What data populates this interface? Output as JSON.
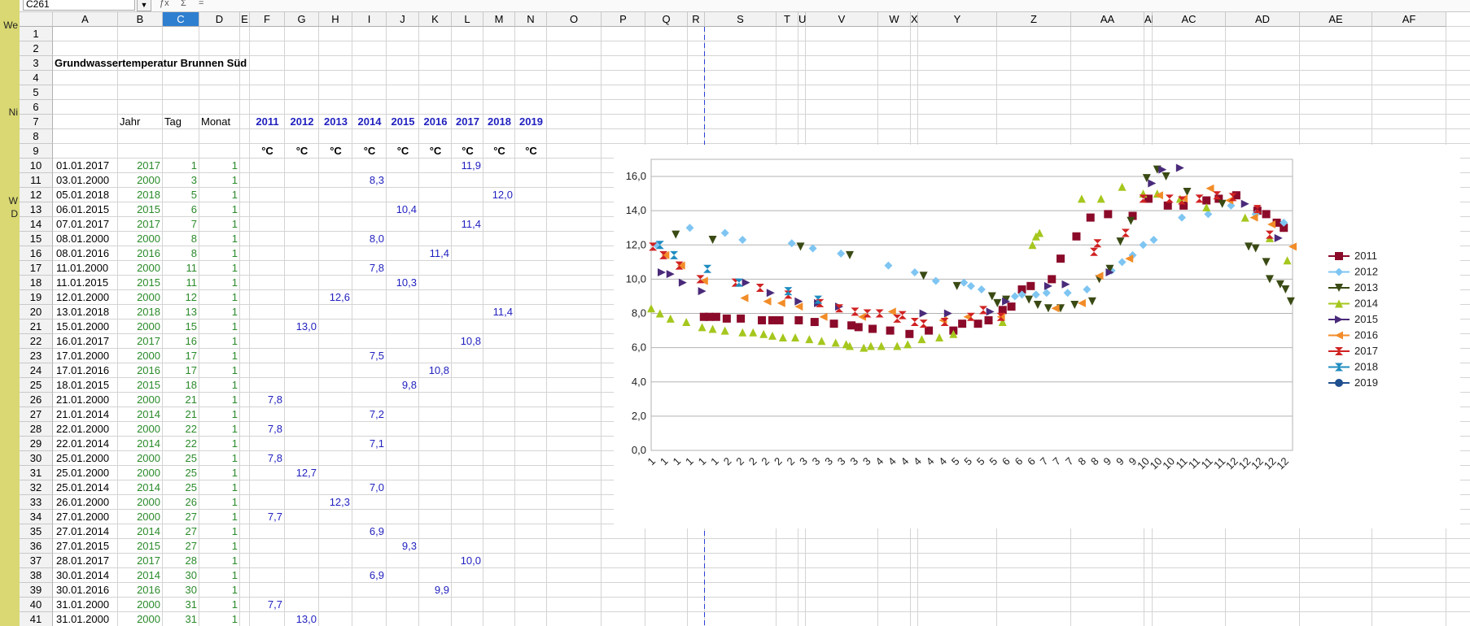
{
  "name_box": "C261",
  "left_strip": [
    "We",
    "Ni",
    "W",
    "D"
  ],
  "toolbar_icons": [
    "function-wizard-icon",
    "sum-icon",
    "formula-icon"
  ],
  "columns": [
    "A",
    "B",
    "C",
    "D",
    "E",
    "F",
    "G",
    "H",
    "I",
    "J",
    "K",
    "L",
    "M",
    "N",
    "O",
    "P",
    "Q",
    "R",
    "S",
    "T",
    "U",
    "V",
    "W",
    "X",
    "Y",
    "Z",
    "AA",
    "AB",
    "AC",
    "AD",
    "AE",
    "AF"
  ],
  "selected_column": "C",
  "title_cell": "Grundwassertemperatur Brunnen Süd",
  "header_labels": {
    "jahr": "Jahr",
    "tag": "Tag",
    "monat": "Monat"
  },
  "year_headers": [
    "2011",
    "2012",
    "2013",
    "2014",
    "2015",
    "2016",
    "2017",
    "2018",
    "2019"
  ],
  "unit": "°C",
  "row_numbers": [
    1,
    2,
    3,
    4,
    5,
    6,
    7,
    8,
    9,
    10,
    11,
    12,
    13,
    14,
    15,
    16,
    17,
    18,
    19,
    20,
    21,
    22,
    23,
    24,
    25,
    26,
    27,
    28,
    29,
    30,
    31,
    32,
    33,
    34,
    35,
    36,
    37,
    38,
    39,
    40,
    41
  ],
  "rows": [
    {
      "date": "01.01.2017",
      "jahr": "2017",
      "tag": "1",
      "monat": "1",
      "col": "L",
      "val": "11,9"
    },
    {
      "date": "03.01.2000",
      "jahr": "2000",
      "tag": "3",
      "monat": "1",
      "col": "I",
      "val": "8,3"
    },
    {
      "date": "05.01.2018",
      "jahr": "2018",
      "tag": "5",
      "monat": "1",
      "col": "M",
      "val": "12,0"
    },
    {
      "date": "06.01.2015",
      "jahr": "2015",
      "tag": "6",
      "monat": "1",
      "col": "J",
      "val": "10,4"
    },
    {
      "date": "07.01.2017",
      "jahr": "2017",
      "tag": "7",
      "monat": "1",
      "col": "L",
      "val": "11,4"
    },
    {
      "date": "08.01.2000",
      "jahr": "2000",
      "tag": "8",
      "monat": "1",
      "col": "I",
      "val": "8,0"
    },
    {
      "date": "08.01.2016",
      "jahr": "2016",
      "tag": "8",
      "monat": "1",
      "col": "K",
      "val": "11,4"
    },
    {
      "date": "11.01.2000",
      "jahr": "2000",
      "tag": "11",
      "monat": "1",
      "col": "I",
      "val": "7,8"
    },
    {
      "date": "11.01.2015",
      "jahr": "2015",
      "tag": "11",
      "monat": "1",
      "col": "J",
      "val": "10,3"
    },
    {
      "date": "12.01.2000",
      "jahr": "2000",
      "tag": "12",
      "monat": "1",
      "col": "H",
      "val": "12,6"
    },
    {
      "date": "13.01.2018",
      "jahr": "2018",
      "tag": "13",
      "monat": "1",
      "col": "M",
      "val": "11,4"
    },
    {
      "date": "15.01.2000",
      "jahr": "2000",
      "tag": "15",
      "monat": "1",
      "col": "G",
      "val": "13,0"
    },
    {
      "date": "16.01.2017",
      "jahr": "2017",
      "tag": "16",
      "monat": "1",
      "col": "L",
      "val": "10,8"
    },
    {
      "date": "17.01.2000",
      "jahr": "2000",
      "tag": "17",
      "monat": "1",
      "col": "I",
      "val": "7,5"
    },
    {
      "date": "17.01.2016",
      "jahr": "2016",
      "tag": "17",
      "monat": "1",
      "col": "K",
      "val": "10,8"
    },
    {
      "date": "18.01.2015",
      "jahr": "2015",
      "tag": "18",
      "monat": "1",
      "col": "J",
      "val": "9,8"
    },
    {
      "date": "21.01.2000",
      "jahr": "2000",
      "tag": "21",
      "monat": "1",
      "col": "F",
      "val": "7,8"
    },
    {
      "date": "21.01.2014",
      "jahr": "2014",
      "tag": "21",
      "monat": "1",
      "col": "I",
      "val": "7,2"
    },
    {
      "date": "22.01.2000",
      "jahr": "2000",
      "tag": "22",
      "monat": "1",
      "col": "F",
      "val": "7,8"
    },
    {
      "date": "22.01.2014",
      "jahr": "2014",
      "tag": "22",
      "monat": "1",
      "col": "I",
      "val": "7,1"
    },
    {
      "date": "25.01.2000",
      "jahr": "2000",
      "tag": "25",
      "monat": "1",
      "col": "F",
      "val": "7,8"
    },
    {
      "date": "25.01.2000",
      "jahr": "2000",
      "tag": "25",
      "monat": "1",
      "col": "G",
      "val": "12,7"
    },
    {
      "date": "25.01.2014",
      "jahr": "2014",
      "tag": "25",
      "monat": "1",
      "col": "I",
      "val": "7,0"
    },
    {
      "date": "26.01.2000",
      "jahr": "2000",
      "tag": "26",
      "monat": "1",
      "col": "H",
      "val": "12,3"
    },
    {
      "date": "27.01.2000",
      "jahr": "2000",
      "tag": "27",
      "monat": "1",
      "col": "F",
      "val": "7,7"
    },
    {
      "date": "27.01.2014",
      "jahr": "2014",
      "tag": "27",
      "monat": "1",
      "col": "I",
      "val": "6,9"
    },
    {
      "date": "27.01.2015",
      "jahr": "2015",
      "tag": "27",
      "monat": "1",
      "col": "J",
      "val": "9,3"
    },
    {
      "date": "28.01.2017",
      "jahr": "2017",
      "tag": "28",
      "monat": "1",
      "col": "L",
      "val": "10,0"
    },
    {
      "date": "30.01.2014",
      "jahr": "2014",
      "tag": "30",
      "monat": "1",
      "col": "I",
      "val": "6,9"
    },
    {
      "date": "30.01.2016",
      "jahr": "2016",
      "tag": "30",
      "monat": "1",
      "col": "K",
      "val": "9,9"
    },
    {
      "date": "31.01.2000",
      "jahr": "2000",
      "tag": "31",
      "monat": "1",
      "col": "F",
      "val": "7,7"
    },
    {
      "date": "31.01.2000",
      "jahr": "2000",
      "tag": "31",
      "monat": "1",
      "col": "G",
      "val": "13,0"
    }
  ],
  "chart_data": {
    "type": "scatter",
    "y_tick_labels": [
      "0,0",
      "2,0",
      "4,0",
      "6,0",
      "8,0",
      "10,0",
      "12,0",
      "14,0",
      "16,0"
    ],
    "x_tick_labels": [
      "1",
      "1",
      "1",
      "1",
      "1",
      "1",
      "2",
      "2",
      "2",
      "2",
      "2",
      "2",
      "3",
      "3",
      "3",
      "3",
      "3",
      "3",
      "4",
      "4",
      "4",
      "4",
      "4",
      "4",
      "5",
      "5",
      "5",
      "5",
      "6",
      "6",
      "6",
      "7",
      "7",
      "7",
      "8",
      "8",
      "9",
      "9",
      "9",
      "10",
      "10",
      "10",
      "11",
      "11",
      "11",
      "11",
      "12",
      "12",
      "12",
      "12",
      "12"
    ],
    "ylim": [
      0,
      17
    ],
    "x_range": [
      0,
      365
    ],
    "grid": "horizontal",
    "legend": "right",
    "series": [
      {
        "name": "2011",
        "color": "#8b0a2a",
        "marker": "square",
        "x": [
          30,
          33,
          37,
          43,
          51,
          63,
          69,
          73,
          84,
          93,
          104,
          114,
          118,
          126,
          136,
          147,
          158,
          172,
          177,
          186,
          192,
          200,
          205,
          211,
          216,
          228,
          233,
          242,
          250,
          260,
          274,
          283,
          294,
          303,
          316,
          323,
          333,
          345,
          350,
          356,
          360
        ],
        "y": [
          7.8,
          7.8,
          7.8,
          7.7,
          7.7,
          7.6,
          7.6,
          7.6,
          7.6,
          7.5,
          7.4,
          7.3,
          7.2,
          7.1,
          7.0,
          6.8,
          7.0,
          7.0,
          7.4,
          7.4,
          7.6,
          8.2,
          8.4,
          9.4,
          9.6,
          10.0,
          11.2,
          12.5,
          13.6,
          13.8,
          13.7,
          14.7,
          14.3,
          14.3,
          14.6,
          14.7,
          14.9,
          14.0,
          13.8,
          13.3,
          13.0
        ]
      },
      {
        "name": "2012",
        "color": "#7ec5f2",
        "marker": "diamond",
        "x": [
          3,
          22,
          42,
          52,
          80,
          92,
          108,
          135,
          150,
          162,
          178,
          182,
          188,
          207,
          211,
          219,
          225,
          237,
          248,
          262,
          268,
          274,
          280,
          286,
          302,
          317,
          330,
          344,
          360
        ],
        "y": [
          12.0,
          13.0,
          12.7,
          12.3,
          12.1,
          11.8,
          11.5,
          10.8,
          10.4,
          9.9,
          9.8,
          9.6,
          9.4,
          9.0,
          9.1,
          9.1,
          9.2,
          9.2,
          9.4,
          10.5,
          11.0,
          11.4,
          12.0,
          12.3,
          13.6,
          13.8,
          14.3,
          13.8,
          13.3
        ]
      },
      {
        "name": "2013",
        "color": "#3a4a14",
        "marker": "triangle-down",
        "x": [
          14,
          35,
          85,
          113,
          155,
          174,
          194,
          197,
          202,
          215,
          220,
          226,
          233,
          241,
          251,
          255,
          261,
          267,
          273,
          282,
          288,
          293,
          305,
          325,
          340,
          344,
          350,
          352,
          358,
          361,
          364
        ],
        "y": [
          12.6,
          12.3,
          11.9,
          11.4,
          10.2,
          9.6,
          9.0,
          8.6,
          8.8,
          8.8,
          8.5,
          8.3,
          8.3,
          8.5,
          8.7,
          10.0,
          10.6,
          12.2,
          13.4,
          15.9,
          16.4,
          16.0,
          15.1,
          14.4,
          11.9,
          11.8,
          11.0,
          10.0,
          9.7,
          9.4,
          8.7
        ]
      },
      {
        "name": "2014",
        "color": "#a5c71e",
        "marker": "triangle-up",
        "x": [
          0,
          5,
          11,
          20,
          29,
          35,
          42,
          52,
          58,
          64,
          69,
          75,
          82,
          90,
          97,
          105,
          111,
          113,
          121,
          125,
          131,
          140,
          146,
          154,
          164,
          172,
          200,
          217,
          219,
          221,
          245,
          256,
          268,
          280,
          288,
          301,
          316,
          338,
          352,
          362
        ],
        "y": [
          8.3,
          8.0,
          7.7,
          7.5,
          7.2,
          7.1,
          7.0,
          6.9,
          6.9,
          6.8,
          6.7,
          6.6,
          6.6,
          6.5,
          6.4,
          6.3,
          6.2,
          6.1,
          6.0,
          6.1,
          6.1,
          6.1,
          6.2,
          6.5,
          6.6,
          6.8,
          7.5,
          12.0,
          12.5,
          12.7,
          14.7,
          14.7,
          15.4,
          15.0,
          15.0,
          14.7,
          14.2,
          13.6,
          12.4,
          11.1
        ]
      },
      {
        "name": "2015",
        "color": "#4a2a7a",
        "marker": "triangle-right",
        "x": [
          6,
          11,
          18,
          29,
          54,
          68,
          84,
          95,
          107,
          155,
          169,
          193,
          202,
          226,
          236,
          261,
          285,
          291,
          301,
          338,
          357
        ],
        "y": [
          10.4,
          10.3,
          9.8,
          9.3,
          9.8,
          9.2,
          8.7,
          8.6,
          8.4,
          8.0,
          8.0,
          8.1,
          8.7,
          9.6,
          9.7,
          10.4,
          15.6,
          16.4,
          16.5,
          14.4,
          12.4
        ]
      },
      {
        "name": "2016",
        "color": "#f28c28",
        "marker": "triangle-left",
        "x": [
          8,
          17,
          30,
          53,
          66,
          74,
          84,
          98,
          120,
          137,
          166,
          180,
          199,
          230,
          245,
          255,
          272,
          289,
          303,
          318,
          329,
          343,
          353,
          365
        ],
        "y": [
          11.4,
          10.8,
          9.9,
          8.9,
          8.7,
          8.6,
          8.4,
          7.8,
          7.8,
          8.1,
          7.6,
          7.8,
          7.8,
          8.3,
          8.6,
          10.2,
          11.2,
          14.9,
          14.7,
          15.3,
          14.6,
          13.6,
          13.2,
          11.9
        ]
      },
      {
        "name": "2017",
        "color": "#d02222",
        "marker": "bowtie",
        "x": [
          1,
          7,
          16,
          28,
          48,
          62,
          78,
          96,
          107,
          116,
          123,
          130,
          140,
          143,
          150,
          155,
          167,
          182,
          189,
          199,
          252,
          254,
          270,
          280,
          295,
          302,
          312,
          322,
          331,
          345,
          352
        ],
        "y": [
          11.9,
          11.4,
          10.8,
          10.0,
          9.8,
          9.5,
          9.1,
          8.6,
          8.3,
          8.1,
          8.0,
          8.0,
          7.7,
          7.9,
          7.5,
          7.4,
          7.5,
          7.8,
          8.2,
          7.8,
          11.6,
          12.1,
          12.7,
          14.7,
          14.7,
          14.6,
          14.7,
          14.9,
          14.8,
          14.1,
          12.6
        ]
      },
      {
        "name": "2018",
        "color": "#1f8cc0",
        "marker": "hourglass",
        "x": [
          5,
          13,
          32,
          50,
          78,
          95
        ],
        "y": [
          12.0,
          11.4,
          10.6,
          9.8,
          9.3,
          8.8
        ]
      },
      {
        "name": "2019",
        "color": "#1f4f8f",
        "marker": "circle",
        "x": [],
        "y": []
      }
    ]
  }
}
